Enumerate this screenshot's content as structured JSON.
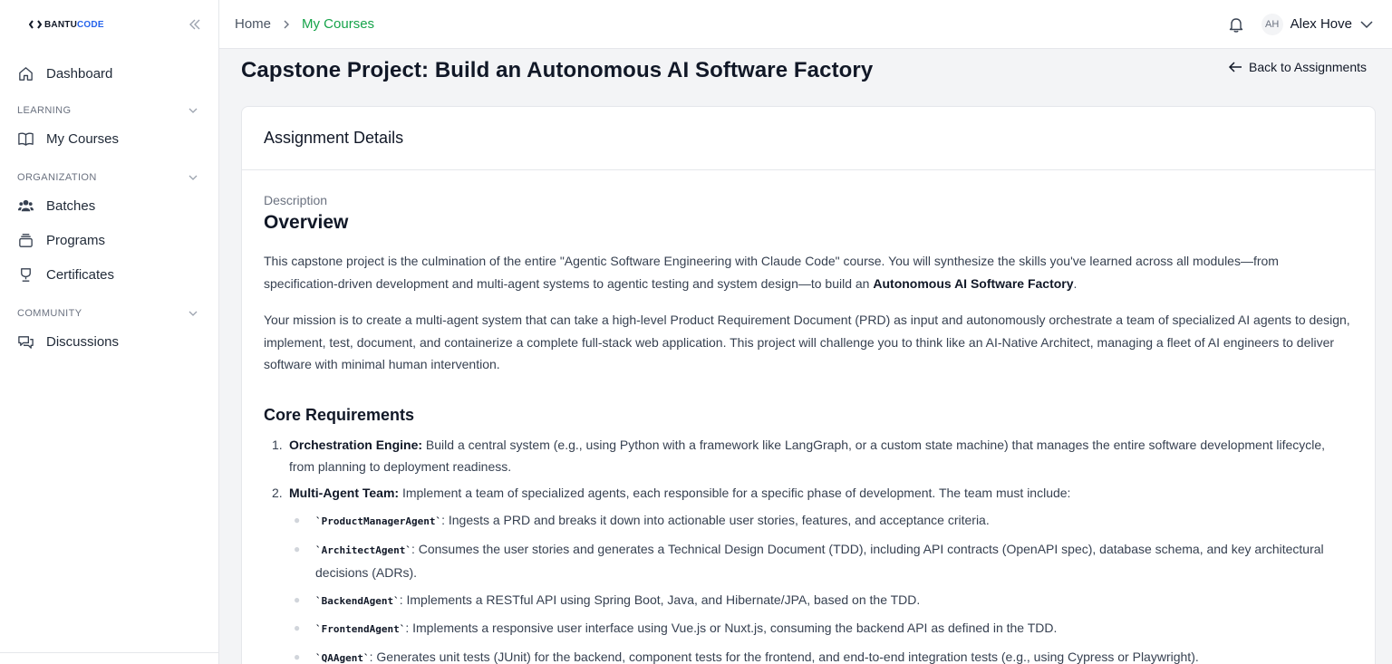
{
  "brand": {
    "part1": "BANTU",
    "part2": "CODE"
  },
  "sidebar": {
    "dashboard": "Dashboard",
    "sections": [
      {
        "title": "LEARNING",
        "items": [
          "My Courses"
        ]
      },
      {
        "title": "ORGANIZATION",
        "items": [
          "Batches",
          "Programs",
          "Certificates"
        ]
      },
      {
        "title": "COMMUNITY",
        "items": [
          "Discussions"
        ]
      }
    ]
  },
  "breadcrumb": {
    "home": "Home",
    "current": "My Courses"
  },
  "user": {
    "initials": "AH",
    "name": "Alex Hove"
  },
  "page": {
    "title": "Capstone Project: Build an Autonomous AI Software Factory",
    "back": "Back to Assignments"
  },
  "card": {
    "header": "Assignment Details",
    "description_label": "Description",
    "overview_heading": "Overview",
    "p1_text": "This capstone project is the culmination of the entire \"Agentic Software Engineering with Claude Code\" course. You will synthesize the skills you've learned across all modules—from specification-driven development and multi-agent systems to agentic testing and system design—to build an ",
    "p1_bold": "Autonomous AI Software Factory",
    "p1_end": ".",
    "p2": "Your mission is to create a multi-agent system that can take a high-level Product Requirement Document (PRD) as input and autonomously orchestrate a team of specialized AI agents to design, implement, test, document, and containerize a complete full-stack web application. This project will challenge you to think like an AI-Native Architect, managing a fleet of AI engineers to deliver software with minimal human intervention.",
    "core_heading": "Core Requirements",
    "requirements": [
      {
        "num": "1.",
        "title": "Orchestration Engine:",
        "text": " Build a central system (e.g., using Python with a framework like LangGraph, or a custom state machine) that manages the entire software development lifecycle, from planning to deployment readiness."
      },
      {
        "num": "2.",
        "title": "Multi-Agent Team:",
        "text": " Implement a team of specialized agents, each responsible for a specific phase of development. The team must include:"
      }
    ],
    "agents": [
      {
        "code": "`ProductManagerAgent`",
        "text": ": Ingests a PRD and breaks it down into actionable user stories, features, and acceptance criteria."
      },
      {
        "code": "`ArchitectAgent`",
        "text": ": Consumes the user stories and generates a Technical Design Document (TDD), including API contracts (OpenAPI spec), database schema, and key architectural decisions (ADRs)."
      },
      {
        "code": "`BackendAgent`",
        "text": ": Implements a RESTful API using Spring Boot, Java, and Hibernate/JPA, based on the TDD."
      },
      {
        "code": "`FrontendAgent`",
        "text": ": Implements a responsive user interface using Vue.js or Nuxt.js, consuming the backend API as defined in the TDD."
      },
      {
        "code": "`QAAgent`",
        "text": ": Generates unit tests (JUnit) for the backend, component tests for the frontend, and end-to-end integration tests (e.g., using Cypress or Playwright)."
      }
    ]
  },
  "colors": {
    "accent": "#16a34a",
    "brand_blue": "#2563eb"
  }
}
